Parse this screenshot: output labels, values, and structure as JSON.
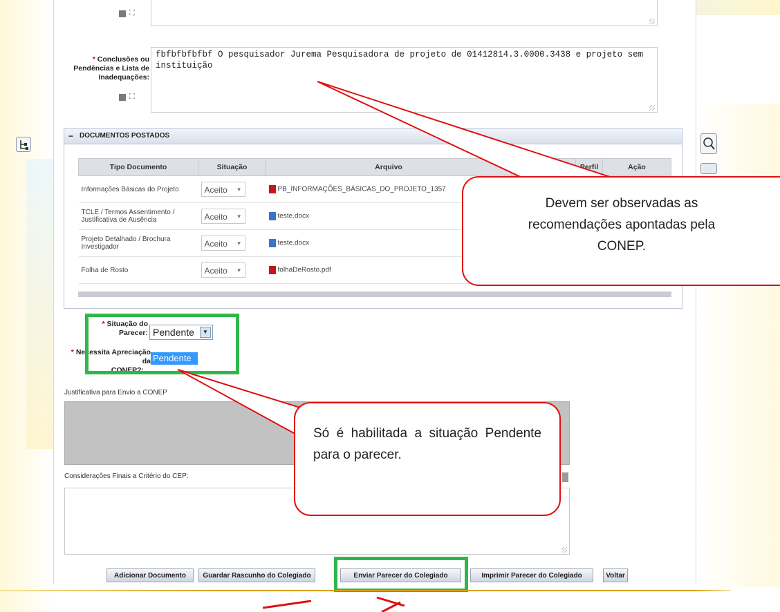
{
  "sidebar_icons": {
    "left": "tree-icon",
    "right_top": "magnifier-icon",
    "right_bottom": "panel-icon"
  },
  "form": {
    "conclusions_label": "Conclusões ou Pendências e Lista de Inadequações:",
    "conclusions_text": "fbfbfbfbfbf O pesquisador Jurema Pesquisadora  de projeto de 01412814.3.0000.3438 e projeto sem instituição",
    "docs_section_title": "DOCUMENTOS POSTADOS",
    "docs_columns": [
      "Tipo Documento",
      "Situação",
      "Arquivo",
      "P",
      "Perfil",
      "Ação"
    ],
    "docs_rows": [
      {
        "tipo": "Informações Básicas do Projeto",
        "situacao": "Aceito",
        "arquivo": "PB_INFORMAÇÕES_BÁSICAS_DO_PROJETO_1357",
        "file_icon": "pdf-icon"
      },
      {
        "tipo": "TCLE / Termos Assentimento / Justificativa de Ausência",
        "situacao": "Aceito",
        "arquivo": "teste.docx",
        "file_icon": "docx-icon"
      },
      {
        "tipo": "Projeto Detalhado / Brochura Investigador",
        "situacao": "Aceito",
        "arquivo": "teste.docx",
        "file_icon": "docx-icon"
      },
      {
        "tipo": "Folha de Rosto",
        "situacao": "Aceito",
        "arquivo": "folhaDeRosto.pdf",
        "file_icon": "pdf-icon"
      }
    ],
    "situacao_parecer_label": "Situação do Parecer:",
    "situacao_parecer_value": "Pendente",
    "situacao_dropdown_option": "Pendente",
    "necessita_label": "Necessita Apreciação da",
    "necessita_label_end": "CONEP?:",
    "justificativa_label": "Justificativa para Envio a CONEP",
    "consideracoes_label": "Considerações Finais a Critério do CEP:"
  },
  "buttons": {
    "adicionar": "Adicionar Documento",
    "guardar": "Guardar Rascunho do Colegiado",
    "enviar": "Enviar Parecer do Colegiado",
    "imprimir": "Imprimir Parecer do Colegiado",
    "voltar": "Voltar"
  },
  "callouts": {
    "conep": "Devem ser observadas as recomendações apontadas pela CONEP.",
    "pendente": "Só é habilitada a situação Pendente para o parecer."
  },
  "colors": {
    "callout_red": "#e01010",
    "highlight_green": "#2eb84a",
    "accent_gold": "#d4a017"
  }
}
